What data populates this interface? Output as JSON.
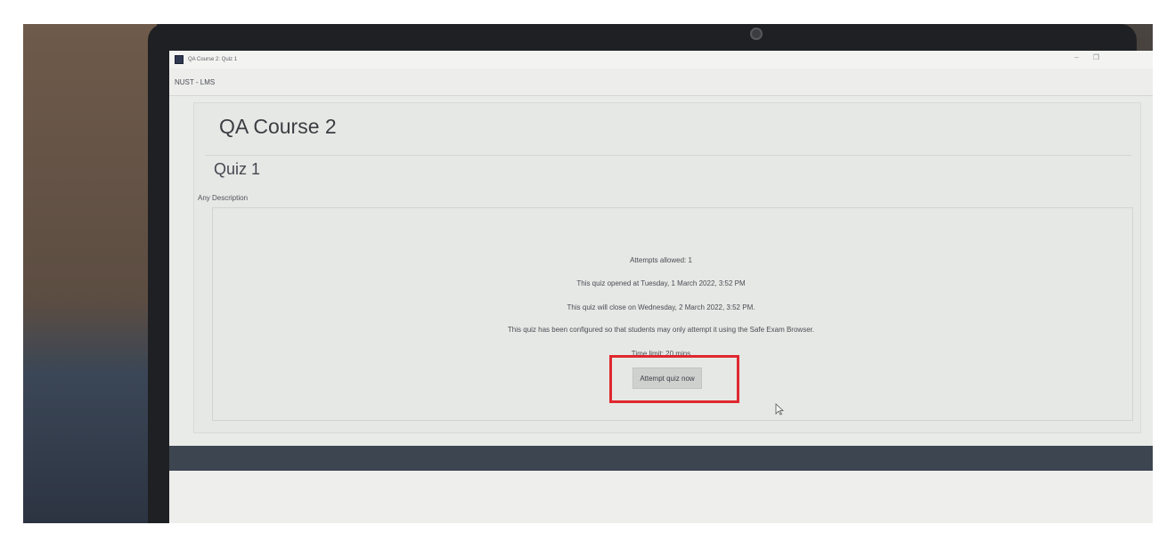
{
  "window": {
    "title": "QA Course 2: Quiz 1",
    "minimize_glyph": "–",
    "restore_glyph": "❐",
    "app_icon": "moodle-app-icon"
  },
  "navbar": {
    "brand": "NUST - LMS"
  },
  "course": {
    "title": "QA Course 2"
  },
  "quiz": {
    "title": "Quiz 1",
    "description": "Any Description",
    "attempts_allowed": "Attempts allowed: 1",
    "opened": "This quiz opened at Tuesday, 1 March 2022, 3:52 PM",
    "closes": "This quiz will close on Wednesday, 2 March 2022, 3:52 PM.",
    "seb_notice": "This quiz has been configured so that students may only attempt it using the Safe Exam Browser.",
    "time_limit": "Time limit: 20 mins",
    "attempt_button_label": "Attempt quiz now"
  },
  "annotation": {
    "highlight_color": "#e0282f"
  },
  "colors": {
    "footer": "#3d4550",
    "screen_background": "#e9ebe8"
  }
}
